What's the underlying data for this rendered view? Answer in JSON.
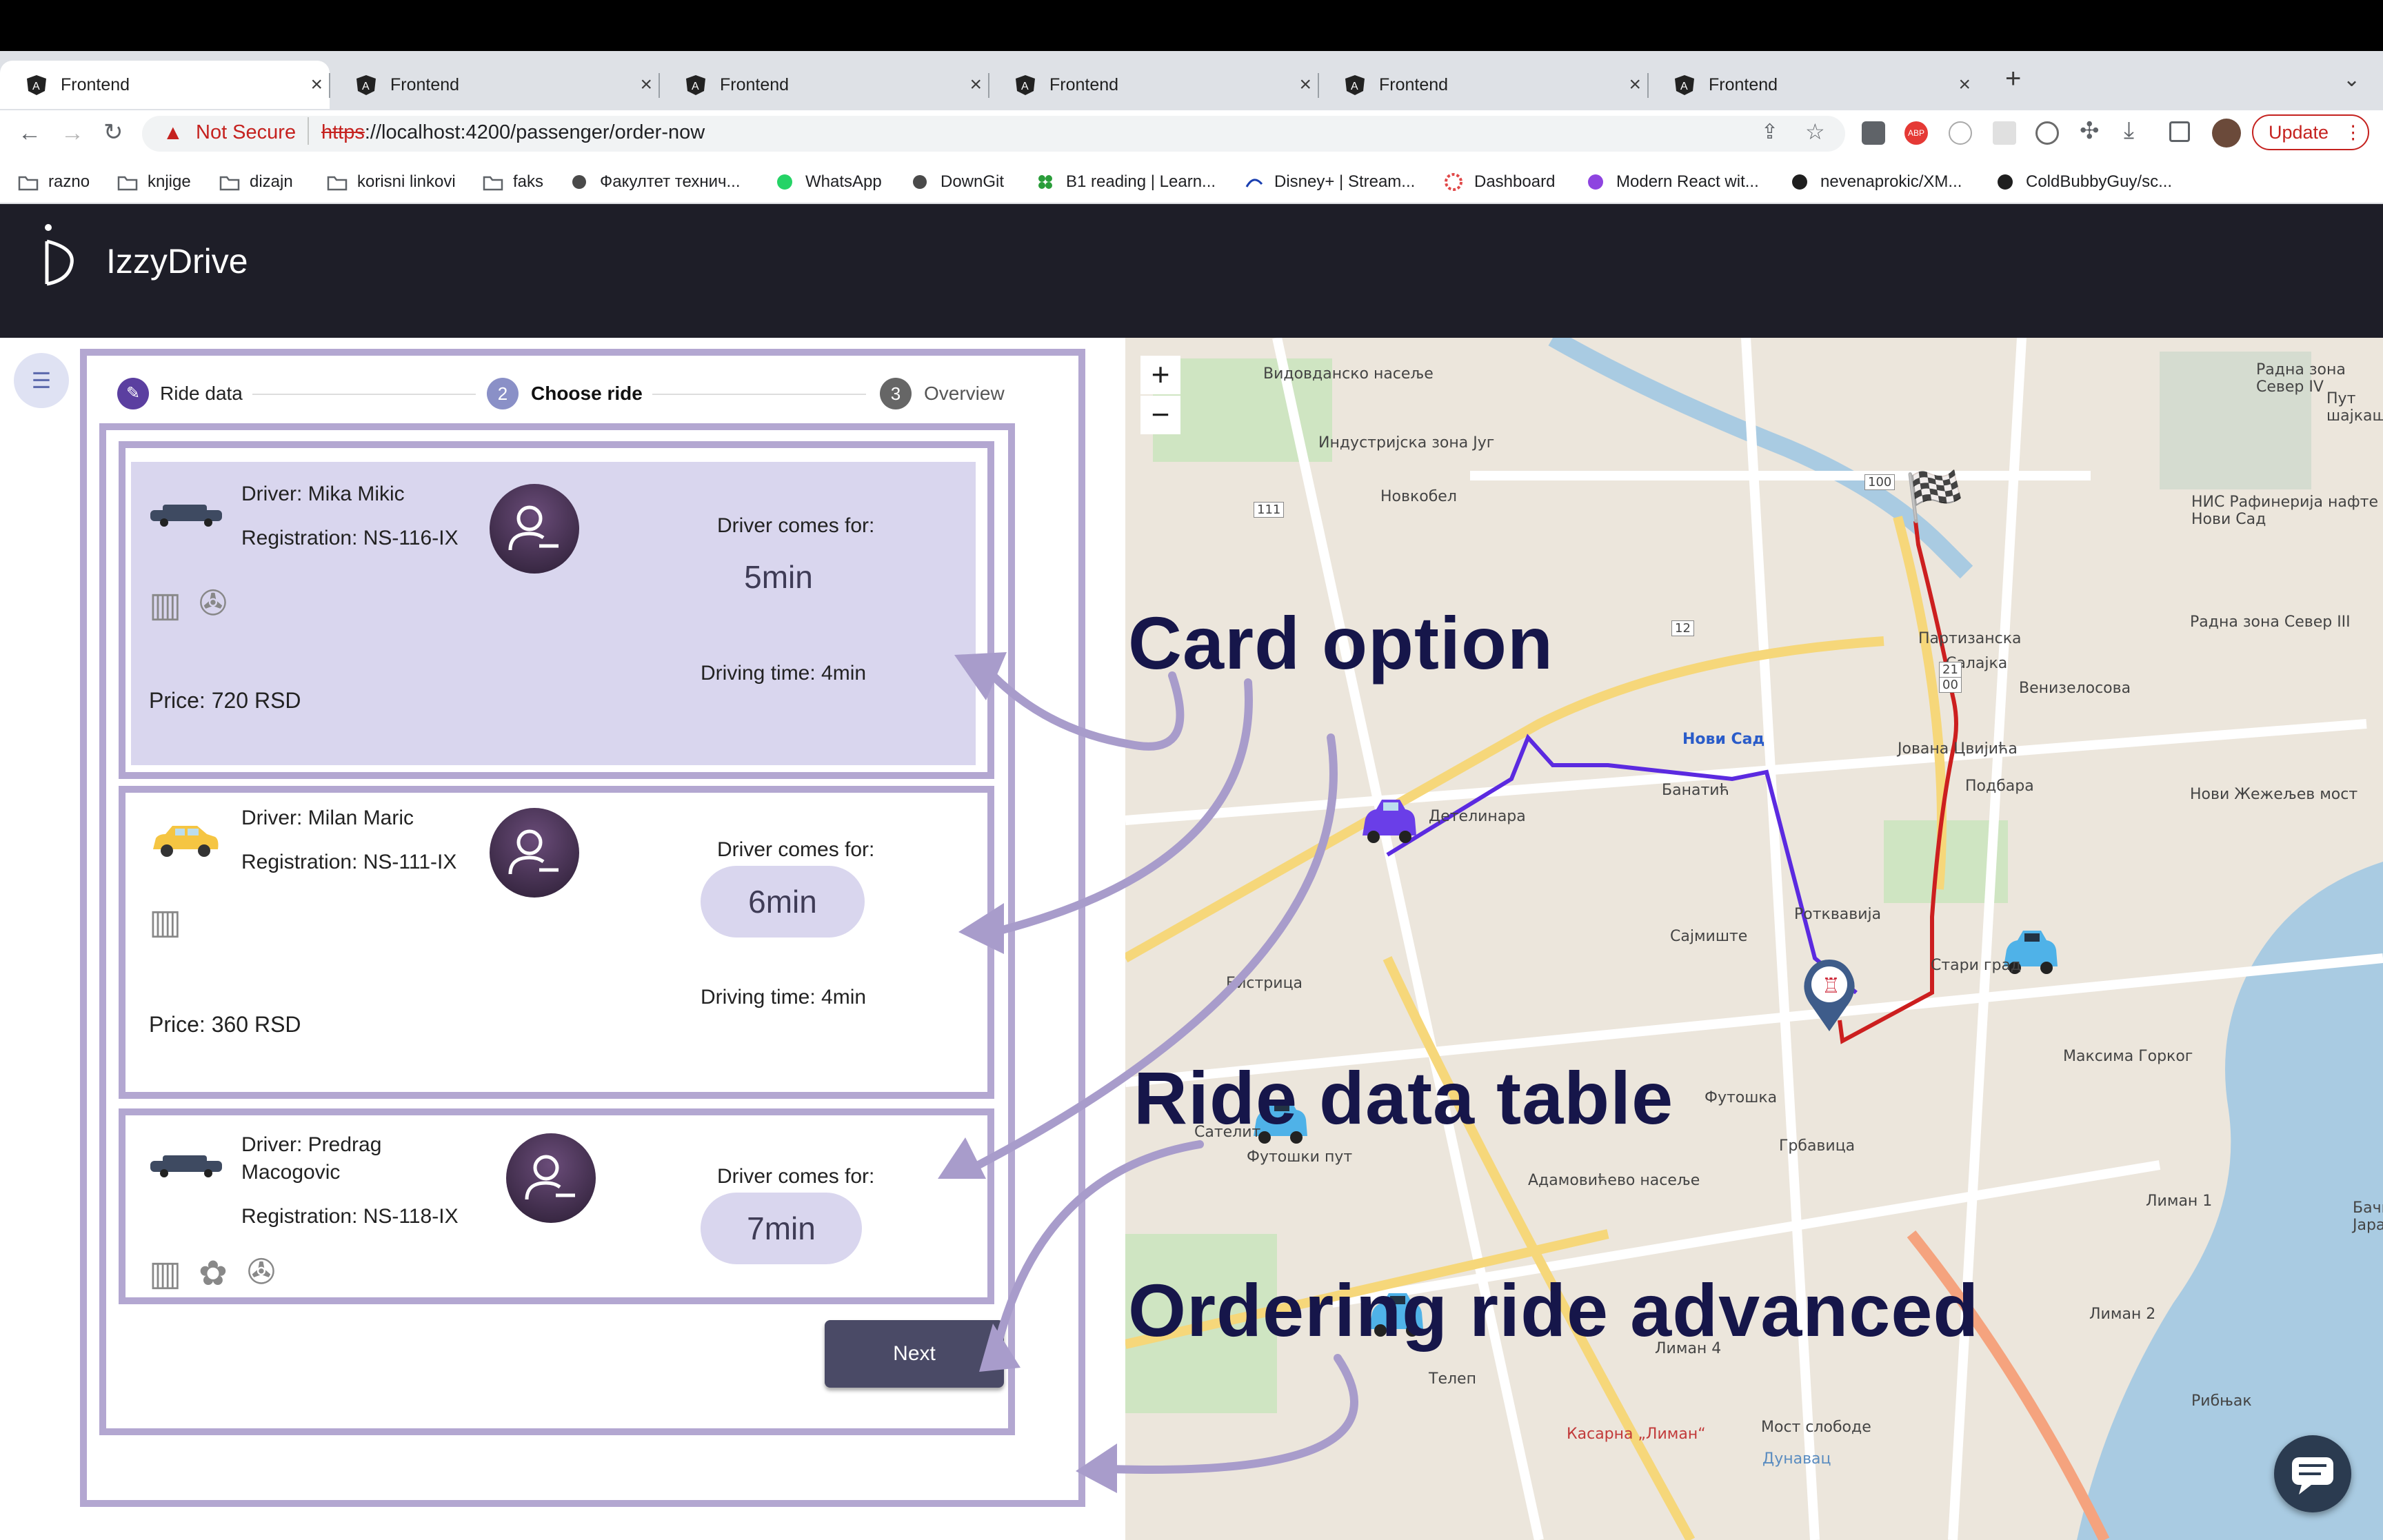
{
  "browser": {
    "tabs": [
      {
        "title": "Frontend",
        "active": true
      },
      {
        "title": "Frontend",
        "active": false
      },
      {
        "title": "Frontend",
        "active": false
      },
      {
        "title": "Frontend",
        "active": false
      },
      {
        "title": "Frontend",
        "active": false
      },
      {
        "title": "Frontend",
        "active": false
      }
    ],
    "security_label": "Not Secure",
    "url_scheme": "https",
    "url_rest": "://localhost:4200/passenger/order-now",
    "update_label": "Update",
    "bookmarks": [
      "razno",
      "knjige",
      "dizajn",
      "korisni linkovi",
      "faks",
      "Факултет технич...",
      "WhatsApp",
      "DownGit",
      "B1 reading | Learn...",
      "Disney+ | Stream...",
      "Dashboard",
      "Modern React wit...",
      "nevenaprokic/XM...",
      "ColdBubbyGuy/sc..."
    ]
  },
  "app": {
    "title": "IzzyDrive"
  },
  "stepper": {
    "step1": "Ride data",
    "step2_num": "2",
    "step2": "Choose ride",
    "step3_num": "3",
    "step3": "Overview"
  },
  "cards": [
    {
      "driver": "Driver: Mika Mikic",
      "registration": "Registration: NS-116-IX",
      "comes_label": "Driver comes for:",
      "minutes": "5min",
      "driving_time": "Driving time: 4min",
      "price": "Price: 720 RSD",
      "car_color": "#3e4a61",
      "selected": true
    },
    {
      "driver": "Driver: Milan Maric",
      "registration": "Registration: NS-111-IX",
      "comes_label": "Driver comes for:",
      "minutes": "6min",
      "driving_time": "Driving time: 4min",
      "price": "Price: 360 RSD",
      "car_color": "#f5c542",
      "selected": false
    },
    {
      "driver_line1": "Driver: Predrag",
      "driver_line2": "Macogovic",
      "registration": "Registration: NS-118-IX",
      "comes_label": "Driver comes for:",
      "minutes": "7min",
      "car_color": "#3e4a61",
      "selected": false
    }
  ],
  "next_label": "Next",
  "map": {
    "zoom_in": "+",
    "zoom_out": "−",
    "labels": [
      "Видовданско насеље",
      "Индустријска зона Југ",
      "Новкобел",
      "Радна зона Север IV",
      "Пут шајкашки",
      "НИС Рафинерија нафте Нови Сад",
      "Радна зона Север III",
      "Партизанска",
      "Салајка",
      "Венизелосова",
      "Нови Сад",
      "Јована Цвијића",
      "Подбара",
      "Нови Жежељев мост",
      "Банатић",
      "Детелинара",
      "Ротквавија",
      "Сајмиште",
      "Стари град",
      "Бистрица",
      "Футошка",
      "Грбавица",
      "Лиман 1",
      "Адамовићево насеље",
      "Лиман 2",
      "Лиман 4",
      "Телеп",
      "Рибњак",
      "Мост слободе",
      "Касарна „Лиман“",
      "Дунавац",
      "Бачки Јарак",
      "Сателит",
      "Футошки пут",
      "Максима Горког"
    ],
    "road_numbers": [
      "100",
      "111",
      "12",
      "21",
      "00"
    ]
  },
  "annotations": {
    "card_option": "Card option",
    "ride_data_table": "Ride data table",
    "ordering_ride_advanced": "Ordering ride advanced"
  },
  "colors": {
    "accent": "#b3a7d1",
    "selected_card": "#d9d6ee",
    "header_bg": "#1e1e28",
    "next_button": "#4a4a66",
    "route_red": "#cc1f1f",
    "route_purple": "#5b2ae0"
  }
}
